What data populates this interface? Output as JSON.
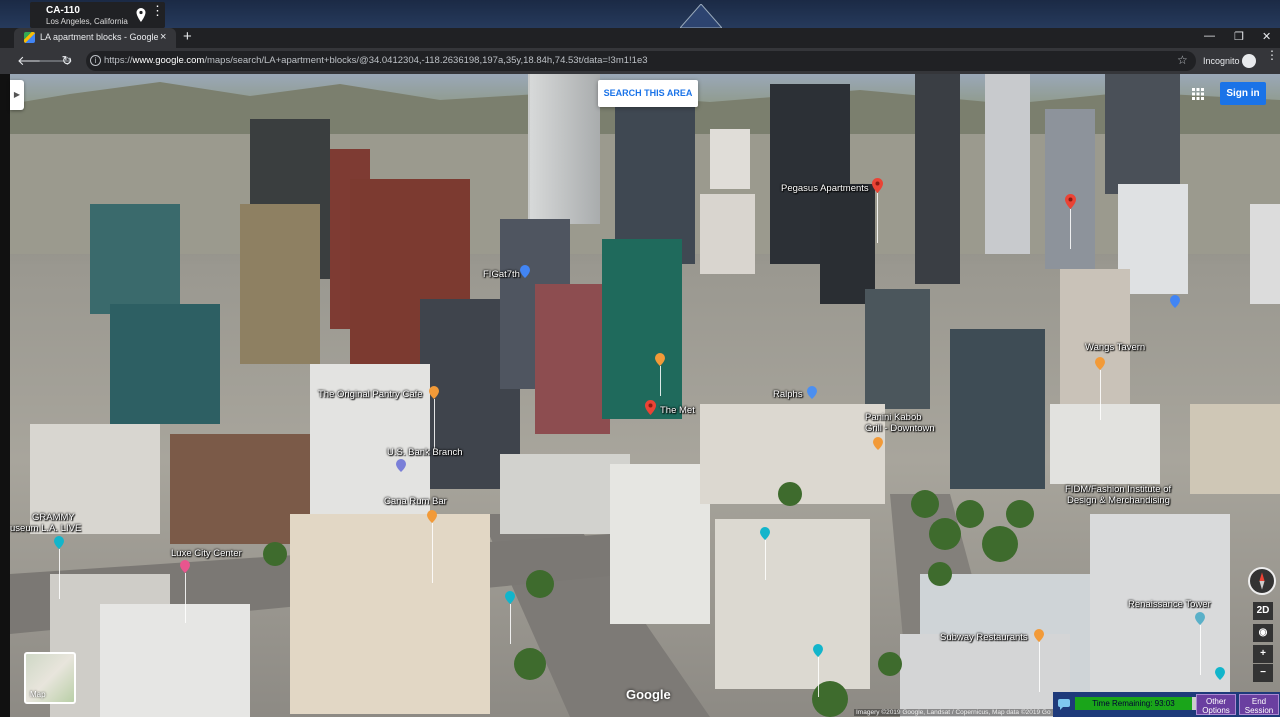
{
  "location_chip": {
    "title": "CA-110",
    "subtitle": "Los Angeles, California"
  },
  "browser": {
    "tab_title": "LA apartment blocks - Google Maps",
    "new_tab": "+",
    "tab_close": "×",
    "window_min": "—",
    "window_restore": "❐",
    "window_close": "✕",
    "url_prefix": "https://",
    "url_host": "www.google.com",
    "url_path": "/maps/search/LA+apartment+blocks/@34.0412304,-118.2636198,197a,35y,18.84h,74.53t/data=!3m1!1e3",
    "incognito_label": "Incognito"
  },
  "map": {
    "search_area_button": "SEARCH THIS AREA",
    "sign_in": "Sign in",
    "thumb_label": "Map",
    "google_logo": "Google",
    "attribution": "Imagery ©2019 Google, Landsat / Copernicus, Map data ©2019 Go",
    "view_toggle": "2D",
    "zoom_in": "+",
    "zoom_out": "−",
    "labels": {
      "pegasus": "Pegasus Apartments",
      "figat7th": "FIGat7th",
      "the_met": "The Met",
      "original_pantry": "The Original Pantry Cafe",
      "us_bank": "U.S. Bank Branch",
      "cana_rum": "Cana Rum Bar",
      "grammy_1": "GRAMMY",
      "grammy_2": "useum L.A. LIVE",
      "luxe": "Luxe City Center",
      "ralphs": "Ralphs",
      "panini_1": "Panini Kabob",
      "panini_2": "Grill - Downtown",
      "wangs": "Wangs Tavern",
      "fidm_1": "FIDM/Fashion Institute of",
      "fidm_2": "Design & Merchandising",
      "renaissance": "Renaissance Tower",
      "subway": "Subway Restaurants"
    }
  },
  "session": {
    "time_remaining": "Time Remaining: 93:03",
    "other_options_1": "Other",
    "other_options_2": "Options",
    "end_session_1": "End",
    "end_session_2": "Session"
  },
  "colors": {
    "accent_blue": "#1a73e8",
    "pin_red": "#ea4335",
    "poi_orange": "#f29a38",
    "timer_green": "#1aa51a",
    "session_purple": "#6a3fa0"
  }
}
